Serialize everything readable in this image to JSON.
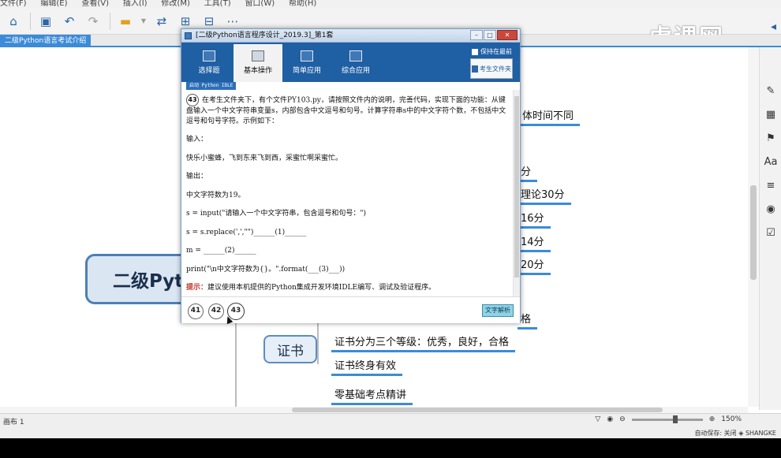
{
  "app": {
    "menu": [
      "文件(F)",
      "编辑(E)",
      "查看(V)",
      "插入(I)",
      "修改(M)",
      "工具(T)",
      "窗口(W)",
      "帮助(H)"
    ],
    "brand": "虎课网",
    "doc_tab": "二级Python语言考试介绍"
  },
  "mindmap": {
    "central": "二级Pytho",
    "cert_node": "证书",
    "leaves": [
      "体时间不同",
      "分",
      "理论30分",
      "16分",
      "14分",
      "20分",
      "格",
      "证书分为三个等级：优秀，良好，合格",
      "证书终身有效",
      "零基础考点精讲"
    ]
  },
  "modal": {
    "title": "[二级Python语言程序设计_2019.3]_第1套",
    "tabs": [
      "选择题",
      "基本操作",
      "简单应用",
      "综合应用"
    ],
    "active_tab": "基本操作",
    "pin_label": "保持在最前",
    "folder_button": "考生文件夹",
    "idle_label": "启动 Python IDLE",
    "question_number": "43",
    "question_text": "在考生文件夹下，有个文件PY103.py，请按照文件内的说明，完善代码，实现下面的功能：从键盘输入一个中文字符串变量s，内部包含中文逗号和句号。计算字符串s中的中文字符个数，不包括中文逗号和句号字符。示例如下：",
    "input_label": "输入：",
    "input_example": "快乐小蜜蜂，飞到东来飞到西，采蜜忙啊采蜜忙。",
    "output_label": "输出：",
    "output_example": "中文字符数为19。",
    "code_line1": "s = input(\"请输入一个中文字符串，包含逗号和句号：\")",
    "code_line2": "s = s.replace(',',\"\")______(1)______",
    "code_line3": "m = ______(2)______",
    "code_line4": "print(\"\\n中文字符数为{}。\".format(___(3)___))",
    "hint_label": "提示：",
    "hint_text": "建议使用本机提供的Python集成开发环境IDLE编写、调试及验证程序。",
    "nav_questions": [
      "41",
      "42",
      "43"
    ],
    "text_analysis": "文字解析"
  },
  "status": {
    "canvas_label": "画布 1",
    "zoom": "150%",
    "autosave": "自动保存: 关闭",
    "brand_small": "SHANGKE"
  }
}
